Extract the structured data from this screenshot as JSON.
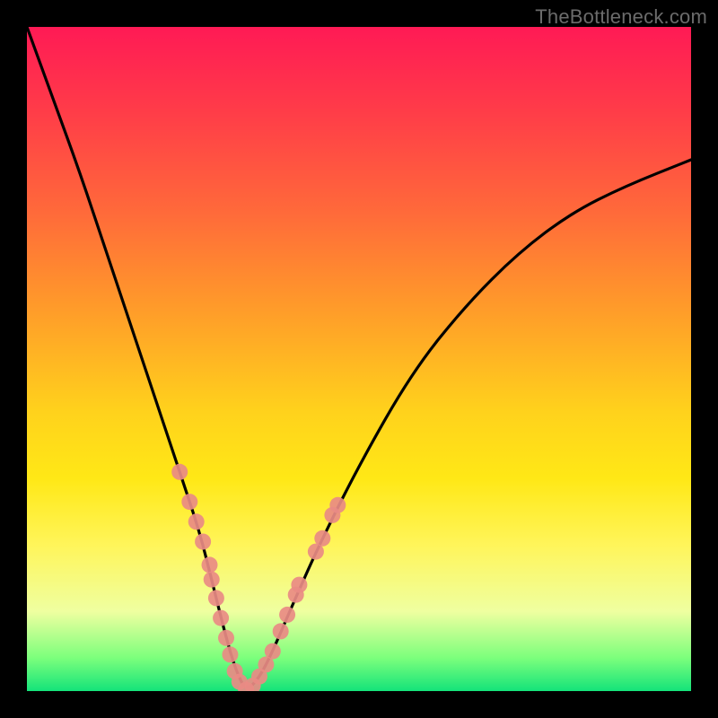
{
  "watermark": "TheBottleneck.com",
  "chart_data": {
    "type": "line",
    "title": "",
    "xlabel": "",
    "ylabel": "",
    "xlim": [
      0,
      100
    ],
    "ylim": [
      0,
      100
    ],
    "grid": false,
    "gradient_background": {
      "top": "#ff1a55",
      "mid_upper": "#ff9a2a",
      "mid_lower": "#fff55a",
      "bottom": "#14e37a"
    },
    "series": [
      {
        "name": "bottleneck-curve",
        "color": "#000000",
        "x": [
          0,
          4,
          8,
          12,
          16,
          20,
          23,
          26,
          28,
          30,
          31.5,
          33,
          35,
          37,
          40,
          44,
          50,
          58,
          66,
          74,
          82,
          90,
          100
        ],
        "y": [
          100,
          89,
          78,
          66,
          54,
          42,
          33,
          24,
          16,
          8,
          3,
          0,
          2,
          6,
          13,
          22,
          34,
          48,
          58,
          66,
          72,
          76,
          80
        ]
      }
    ],
    "markers": {
      "name": "highlight-points",
      "color": "#e98b84",
      "radius": 9,
      "points": [
        {
          "x": 23.0,
          "y": 33.0
        },
        {
          "x": 24.5,
          "y": 28.5
        },
        {
          "x": 25.5,
          "y": 25.5
        },
        {
          "x": 26.5,
          "y": 22.5
        },
        {
          "x": 27.5,
          "y": 19.0
        },
        {
          "x": 27.8,
          "y": 16.8
        },
        {
          "x": 28.5,
          "y": 14.0
        },
        {
          "x": 29.2,
          "y": 11.0
        },
        {
          "x": 30.0,
          "y": 8.0
        },
        {
          "x": 30.6,
          "y": 5.5
        },
        {
          "x": 31.3,
          "y": 3.0
        },
        {
          "x": 32.0,
          "y": 1.4
        },
        {
          "x": 33.0,
          "y": 0.2
        },
        {
          "x": 34.0,
          "y": 0.8
        },
        {
          "x": 35.0,
          "y": 2.2
        },
        {
          "x": 36.0,
          "y": 4.0
        },
        {
          "x": 37.0,
          "y": 6.0
        },
        {
          "x": 38.2,
          "y": 9.0
        },
        {
          "x": 39.2,
          "y": 11.5
        },
        {
          "x": 40.5,
          "y": 14.5
        },
        {
          "x": 41.0,
          "y": 16.0
        },
        {
          "x": 43.5,
          "y": 21.0
        },
        {
          "x": 44.5,
          "y": 23.0
        },
        {
          "x": 46.0,
          "y": 26.5
        },
        {
          "x": 46.8,
          "y": 28.0
        }
      ]
    }
  }
}
